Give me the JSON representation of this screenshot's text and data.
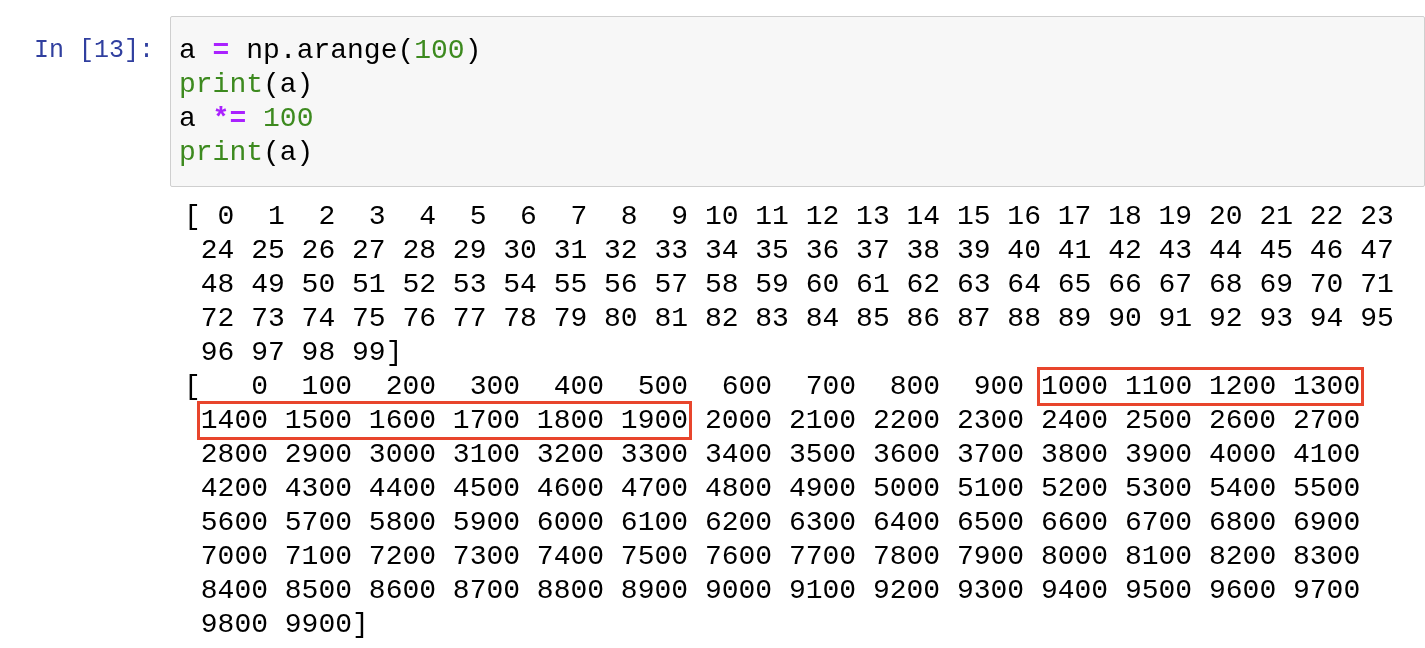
{
  "cell": {
    "prompt": "In [13]:",
    "code_lines": [
      [
        {
          "kind": "name",
          "text": "a "
        },
        {
          "kind": "operator",
          "text": "="
        },
        {
          "kind": "name",
          "text": " np.arange("
        },
        {
          "kind": "number",
          "text": "100"
        },
        {
          "kind": "name",
          "text": ")"
        }
      ],
      [
        {
          "kind": "builtin",
          "text": "print"
        },
        {
          "kind": "name",
          "text": "(a)"
        }
      ],
      [
        {
          "kind": "name",
          "text": "a "
        },
        {
          "kind": "operator",
          "text": "*="
        },
        {
          "kind": "number",
          "text": " 100"
        }
      ],
      [
        {
          "kind": "builtin",
          "text": "print"
        },
        {
          "kind": "name",
          "text": "(a)"
        }
      ]
    ],
    "output_lines": [
      [
        {
          "text": "[ 0  1  2  3  4  5  6  7  8  9 10 11 12 13 14 15 16 17 18 19 20 21 22 23",
          "highlighted": false
        }
      ],
      [
        {
          "text": " 24 25 26 27 28 29 30 31 32 33 34 35 36 37 38 39 40 41 42 43 44 45 46 47",
          "highlighted": false
        }
      ],
      [
        {
          "text": " 48 49 50 51 52 53 54 55 56 57 58 59 60 61 62 63 64 65 66 67 68 69 70 71",
          "highlighted": false
        }
      ],
      [
        {
          "text": " 72 73 74 75 76 77 78 79 80 81 82 83 84 85 86 87 88 89 90 91 92 93 94 95",
          "highlighted": false
        }
      ],
      [
        {
          "text": " 96 97 98 99]",
          "highlighted": false
        }
      ],
      [
        {
          "text": "[   0  100  200  300  400  500  600  700  800  900 ",
          "highlighted": false
        },
        {
          "text": "1000 1100 1200 1300",
          "highlighted": true
        }
      ],
      [
        {
          "text": "1400 1500 1600 1700 1800 1900",
          "highlighted": true
        },
        {
          "text": " 2000 2100 2200 2300 2400 2500 2600 2700",
          "highlighted": false
        }
      ],
      [
        {
          "text": " 2800 2900 3000 3100 3200 3300 3400 3500 3600 3700 3800 3900 4000 4100",
          "highlighted": false
        }
      ],
      [
        {
          "text": " 4200 4300 4400 4500 4600 4700 4800 4900 5000 5100 5200 5300 5400 5500",
          "highlighted": false
        }
      ],
      [
        {
          "text": " 5600 5700 5800 5900 6000 6100 6200 6300 6400 6500 6600 6700 6800 6900",
          "highlighted": false
        }
      ],
      [
        {
          "text": " 7000 7100 7200 7300 7400 7500 7600 7700 7800 7900 8000 8100 8200 8300",
          "highlighted": false
        }
      ],
      [
        {
          "text": " 8400 8500 8600 8700 8800 8900 9000 9100 9200 9300 9400 9500 9600 9700",
          "highlighted": false
        }
      ],
      [
        {
          "text": " 9800 9900]",
          "highlighted": false
        }
      ]
    ]
  }
}
